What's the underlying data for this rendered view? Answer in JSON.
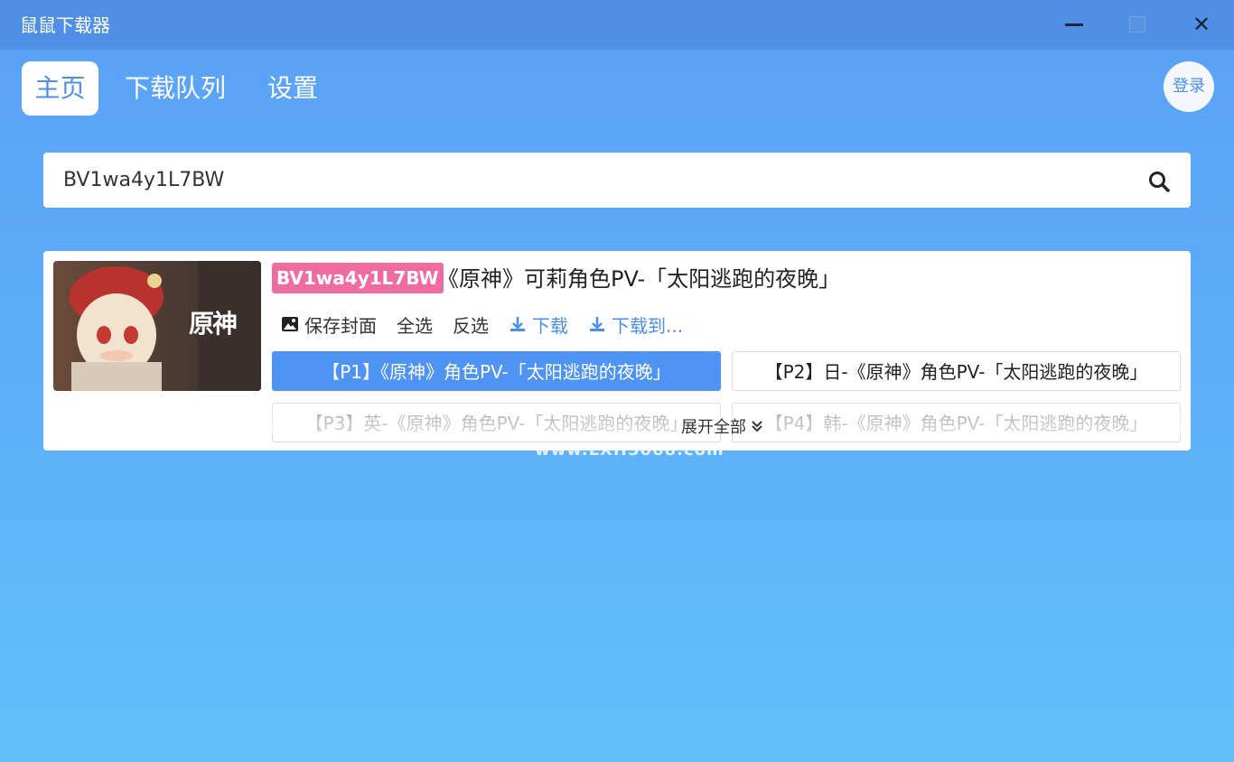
{
  "window": {
    "title": "鼠鼠下载器"
  },
  "nav": {
    "tabs": [
      {
        "label": "主页"
      },
      {
        "label": "下载队列"
      },
      {
        "label": "设置"
      }
    ],
    "login_label": "登录"
  },
  "search": {
    "value": "BV1wa4y1L7BW"
  },
  "video": {
    "bv_id": "BV1wa4y1L7BW",
    "title": "《原神》可莉角色PV-「太阳逃跑的夜晚」",
    "cover_logo_text": "原神",
    "actions": {
      "save_cover": "保存封面",
      "select_all": "全选",
      "invert": "反选",
      "download": "下载",
      "download_to": "下载到..."
    },
    "parts": [
      {
        "label": "【P1】《原神》角色PV-「太阳逃跑的夜晚」",
        "selected": true
      },
      {
        "label": "【P2】日-《原神》角色PV-「太阳逃跑的夜晚」",
        "selected": false
      },
      {
        "label": "【P3】英-《原神》角色PV-「太阳逃跑的夜晚」",
        "selected": false
      },
      {
        "label": "【P4】韩-《原神》角色PV-「太阳逃跑的夜晚」",
        "selected": false
      }
    ],
    "expand_label": "展开全部"
  },
  "watermark": "www.LXH5068.com",
  "colors": {
    "titlebar": "#4f8fe6",
    "accent": "#4a8ef0",
    "badge": "#f06b9f",
    "selected_part": "#4f93f3"
  }
}
